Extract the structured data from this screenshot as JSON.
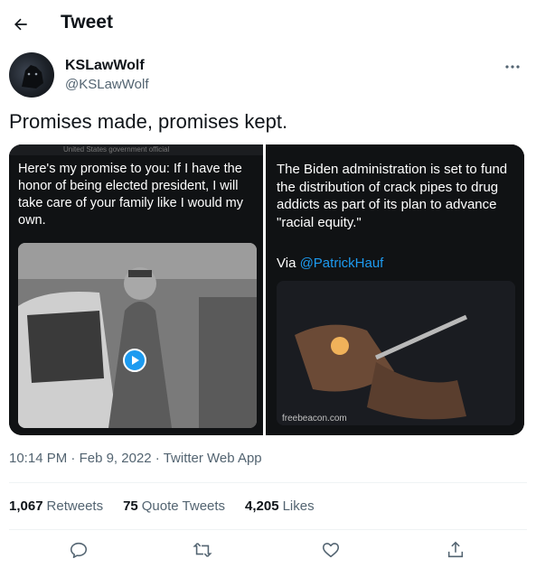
{
  "header": {
    "title": "Tweet"
  },
  "author": {
    "display_name": "KSLawWolf",
    "handle": "@KSLawWolf"
  },
  "tweet": {
    "text": "Promises made, promises kept."
  },
  "media": {
    "left": {
      "top_strip": "United States government official",
      "quote": "Here's my promise to you: If I have the honor of being elected president, I will take care of your family like I would my own."
    },
    "right": {
      "text": "The Biden administration is set to fund the distribution of crack pipes to drug addicts as part of its plan to advance \"racial equity.\"",
      "via_prefix": "Via ",
      "via_mention": "@PatrickHauf",
      "source": "freebeacon.com"
    }
  },
  "meta": {
    "time": "10:14 PM",
    "sep1": " · ",
    "date": "Feb 9, 2022",
    "sep2": " · ",
    "client": "Twitter Web App"
  },
  "stats": {
    "retweets_count": "1,067",
    "retweets_label": "Retweets",
    "quotes_count": "75",
    "quotes_label": "Quote Tweets",
    "likes_count": "4,205",
    "likes_label": "Likes"
  },
  "colors": {
    "accent": "#1d9bf0",
    "text": "#0f1419",
    "muted": "#536471",
    "divider": "#eff3f4"
  },
  "icons": [
    "back-arrow-icon",
    "more-icon",
    "reply-icon",
    "retweet-icon",
    "like-icon",
    "share-icon",
    "play-icon"
  ]
}
